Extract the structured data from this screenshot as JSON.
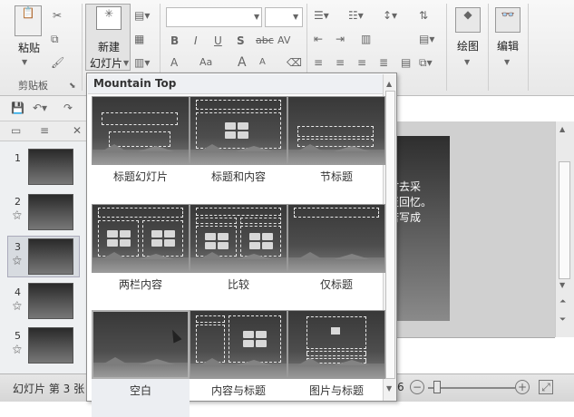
{
  "ribbon": {
    "paste_label": "粘贴",
    "new_slide_label_1": "新建",
    "new_slide_label_2": "幻灯片",
    "clipboard_group": "剪贴板",
    "drawing_label": "绘图",
    "editing_label": "编辑",
    "font_bold": "B",
    "font_italic": "I",
    "font_underline": "U",
    "font_shadow": "S",
    "font_strike": "abc",
    "font_spacing": "AV",
    "font_color": "A",
    "font_case": "Aa",
    "font_grow": "A",
    "font_shrink": "A"
  },
  "gallery": {
    "title": "Mountain Top",
    "layouts": [
      {
        "label": "标题幻灯片"
      },
      {
        "label": "标题和内容"
      },
      {
        "label": "节标题"
      },
      {
        "label": "两栏内容"
      },
      {
        "label": "比较"
      },
      {
        "label": "仅标题"
      },
      {
        "label": "空白"
      },
      {
        "label": "内容与标题"
      },
      {
        "label": "图片与标题"
      }
    ]
  },
  "slides_panel": {
    "numbers": [
      "1",
      "2",
      "3",
      "4",
      "5"
    ]
  },
  "slide_text": "时去采\n至回忆。\n若写成",
  "status": {
    "slide_info": "幻灯片 第 3 张",
    "zoom_tail": "6"
  }
}
